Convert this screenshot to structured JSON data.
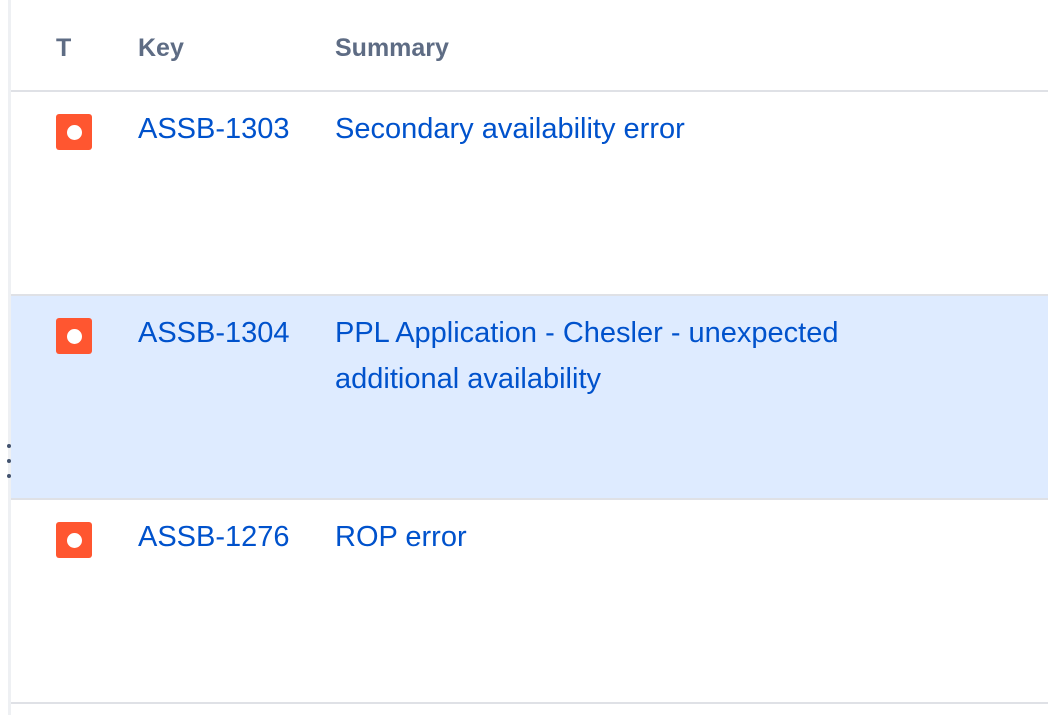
{
  "columns": {
    "type": "T",
    "key": "Key",
    "summary": "Summary"
  },
  "issues": [
    {
      "type_icon": "bug-icon",
      "key": "ASSB-1303",
      "summary": "Secondary availability error",
      "selected": false
    },
    {
      "type_icon": "bug-icon",
      "key": "ASSB-1304",
      "summary": "PPL Application - Chesler - unexpected additional availability",
      "selected": true
    },
    {
      "type_icon": "bug-icon",
      "key": "ASSB-1276",
      "summary": "ROP error",
      "selected": false
    }
  ],
  "colors": {
    "bug": "#ff5630",
    "link": "#0052cc",
    "header_text": "#5e6c84",
    "selected_row": "#deebff",
    "divider": "#dfe1e6"
  },
  "icons": {
    "row_handle": "drag-handle-icon"
  }
}
